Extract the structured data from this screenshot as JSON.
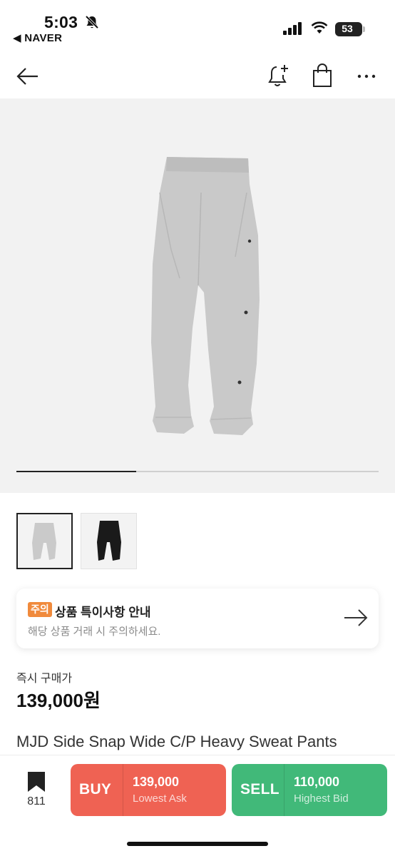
{
  "status_bar": {
    "time": "5:03",
    "back_app": "◀ NAVER",
    "battery": "53"
  },
  "icons": {
    "back": "arrow-left-icon",
    "alert": "bell-plus-icon",
    "bag": "shopping-bag-icon",
    "more": "more-dots-icon",
    "notice_arrow": "arrow-right-icon",
    "wishlist": "bookmark-icon"
  },
  "gallery": {
    "progress": 0.33,
    "thumbnails": [
      {
        "label": "grey",
        "selected": true
      },
      {
        "label": "black",
        "selected": false
      }
    ]
  },
  "notice": {
    "badge": "주의",
    "title": "상품 특이사항 안내",
    "subtitle": "해당 상품 거래 시 주의하세요."
  },
  "price": {
    "label": "즉시 구매가",
    "value": "139,000원"
  },
  "product": {
    "name": "MJD Side Snap Wide C/P Heavy Sweat Pants"
  },
  "bottom": {
    "wish_count": "811",
    "buy": {
      "label": "BUY",
      "price": "139,000",
      "sub": "Lowest Ask"
    },
    "sell": {
      "label": "SELL",
      "price": "110,000",
      "sub": "Highest Bid"
    }
  },
  "colors": {
    "buy": "#ef6253",
    "sell": "#41b979",
    "notice_badge": "#f08a3c"
  }
}
